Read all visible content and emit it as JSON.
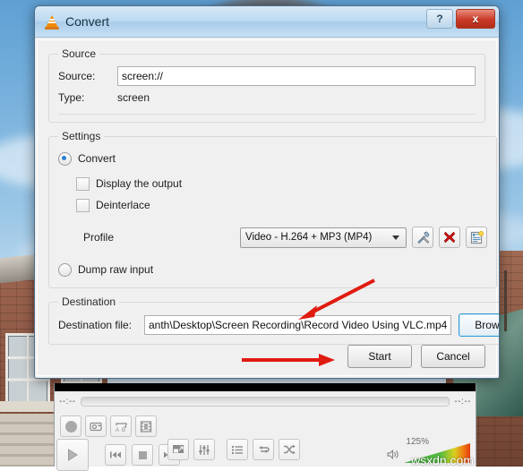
{
  "dialog": {
    "title": "Convert",
    "app_icon": "vlc-cone-icon",
    "help_label": "?",
    "close_label": "x",
    "source": {
      "legend": "Source",
      "source_label": "Source:",
      "source_value": "screen://",
      "type_label": "Type:",
      "type_value": "screen"
    },
    "settings": {
      "legend": "Settings",
      "convert_label": "Convert",
      "convert_selected": true,
      "display_output_label": "Display the output",
      "display_output_checked": false,
      "deinterlace_label": "Deinterlace",
      "deinterlace_checked": false,
      "profile_label": "Profile",
      "profile_value": "Video - H.264 + MP3 (MP4)",
      "profile_edit_icon": "tools-icon",
      "profile_delete_icon": "red-x-icon",
      "profile_new_icon": "new-profile-icon",
      "dump_raw_label": "Dump raw input",
      "dump_raw_selected": false
    },
    "destination": {
      "legend": "Destination",
      "file_label": "Destination file:",
      "file_value": "anth\\Desktop\\Screen Recording\\Record Video Using VLC.mp4",
      "browse_label": "Browse"
    },
    "footer": {
      "start_label": "Start",
      "cancel_label": "Cancel"
    }
  },
  "player": {
    "time_elapsed": "--:--",
    "time_total": "--:--",
    "record_icon": "record-icon",
    "snapshot_icon": "snapshot-icon",
    "ab_loop_icon": "ab-loop-icon",
    "frame_icon": "frame-by-frame-icon",
    "play_icon": "play-icon",
    "previous_icon": "previous-icon",
    "stop_icon": "stop-icon",
    "next_icon": "next-icon",
    "fullscreen_icon": "fullscreen-icon",
    "extended_icon": "extended-settings-icon",
    "playlist_icon": "playlist-icon",
    "loop_icon": "loop-icon",
    "shuffle_icon": "shuffle-icon",
    "volume_icon": "speaker-icon",
    "volume_label": "125%"
  },
  "annotations": {
    "watermark": "wsxdn.com",
    "arrow_color": "#e01b10",
    "arrow_to_destination": "arrow pointing to destination file field",
    "arrow_to_start": "arrow pointing to Start button"
  }
}
